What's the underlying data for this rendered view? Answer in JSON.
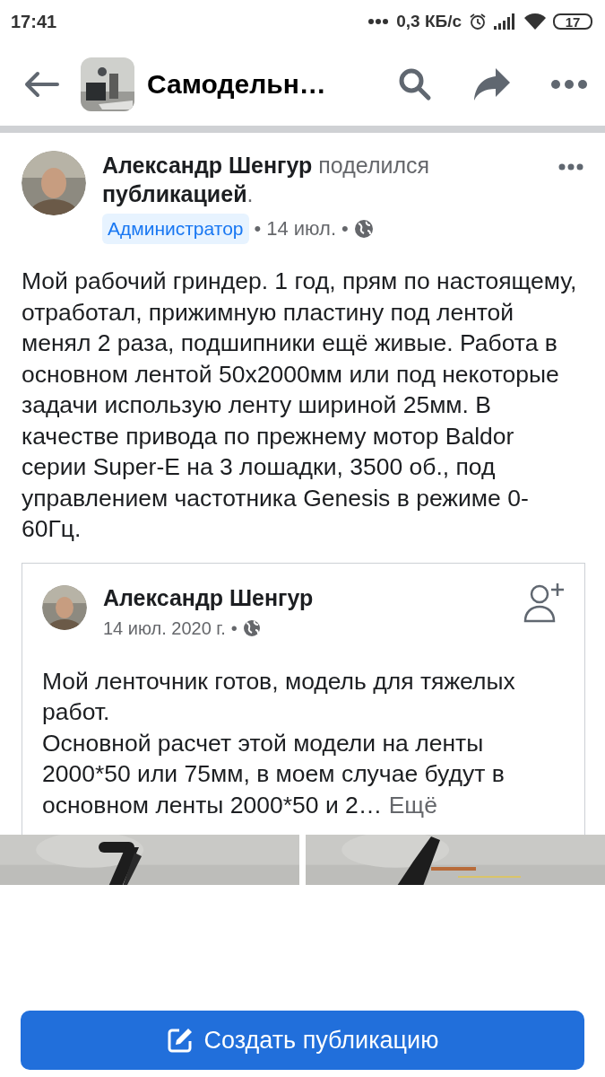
{
  "status_bar": {
    "time": "17:41",
    "speed": "0,3 КБ/с",
    "battery": "17"
  },
  "header": {
    "title": "Самодельн…"
  },
  "post": {
    "author": "Александр Шенгур",
    "action": "поделился",
    "object": "публикацией",
    "punct": ".",
    "badge": "Администратор",
    "separator": "•",
    "date": "14 июл.",
    "separator_2": "•",
    "text": "Мой рабочий гриндер. 1 год, прям по настоящему, отработал, прижимную пластину под лентой менял 2 раза, подшипники ещё живые. Работа в основном лентой 50х2000мм или под некоторые задачи использую ленту шириной 25мм. В качестве привода по прежнему мотор Baldor серии Super-E на 3 лошадки, 3500 об., под управлением частотника Genesis в режиме 0-60Гц."
  },
  "shared": {
    "author": "Александр Шенгур",
    "date": "14 июл. 2020 г.",
    "separator": "•",
    "paragraphs": [
      "Мой ленточник готов, модель для тяжелых работ.",
      "Основной расчет этой модели на ленты 2000*50 или 75мм, в моем случае будут в основном ленты 2000*50 и 2…"
    ],
    "more": "Ещё"
  },
  "create_button": "Создать публикацию"
}
